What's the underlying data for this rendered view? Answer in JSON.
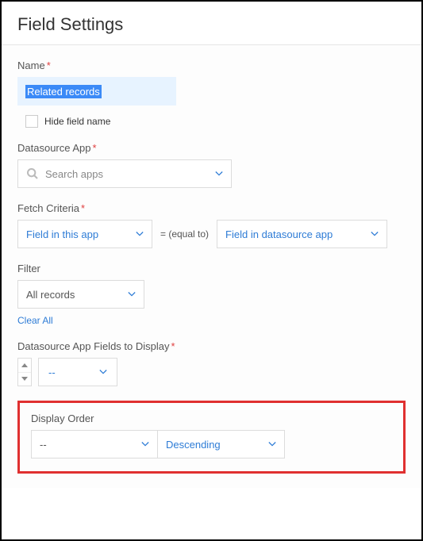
{
  "header": {
    "title": "Field Settings"
  },
  "name": {
    "label": "Name",
    "value": "Related records",
    "hide_checkbox_label": "Hide field name"
  },
  "datasource": {
    "label": "Datasource App",
    "placeholder": "Search apps"
  },
  "fetch": {
    "label": "Fetch Criteria",
    "left": "Field in this app",
    "operator": "= (equal to)",
    "right": "Field in datasource app"
  },
  "filter": {
    "label": "Filter",
    "value": "All records",
    "clear": "Clear All"
  },
  "fields_display": {
    "label": "Datasource App Fields to Display",
    "value": "--"
  },
  "display_order": {
    "label": "Display Order",
    "field": "--",
    "direction": "Descending"
  }
}
